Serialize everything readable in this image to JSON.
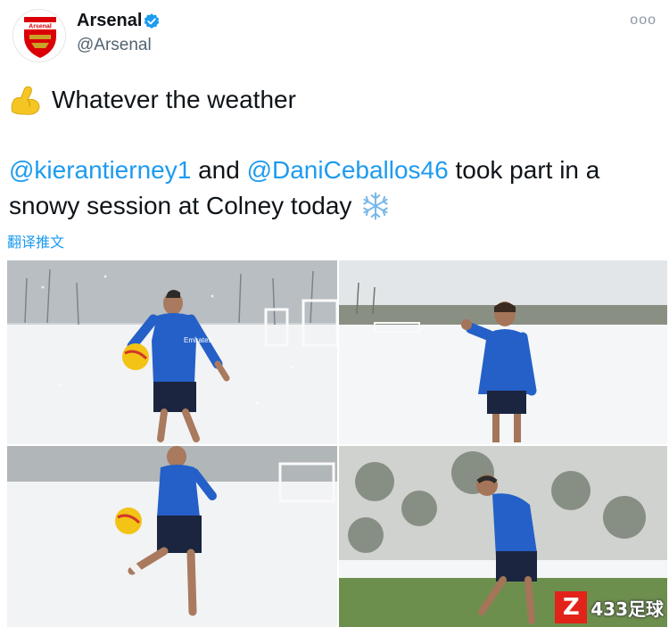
{
  "tweet": {
    "author": {
      "display_name": "Arsenal",
      "handle": "@Arsenal",
      "verified": true,
      "avatar_logo_text": "Arsenal"
    },
    "more_menu_label": "ooo",
    "text_line1": "Whatever the weather",
    "text_line1_icon": "flexed-biceps-icon",
    "mention1": "@kierantierney1",
    "connector1": " and ",
    "mention2": "@DaniCeballos46",
    "connector2": " took part in a",
    "text_line3": "snowy session at Colney today",
    "text_line3_icon": "snowflake-icon",
    "translate_label": "翻译推文",
    "media": {
      "count": 4,
      "photo1_shirt_text": "Emirates",
      "watermark_letter": "Z",
      "watermark_text": "433足球"
    }
  },
  "colors": {
    "link": "#1d9bf0",
    "text": "#0f1419",
    "secondary": "#536471",
    "arsenal_red": "#db0007",
    "kit_blue": "#2460c8",
    "snow": "#f2f4f6"
  }
}
